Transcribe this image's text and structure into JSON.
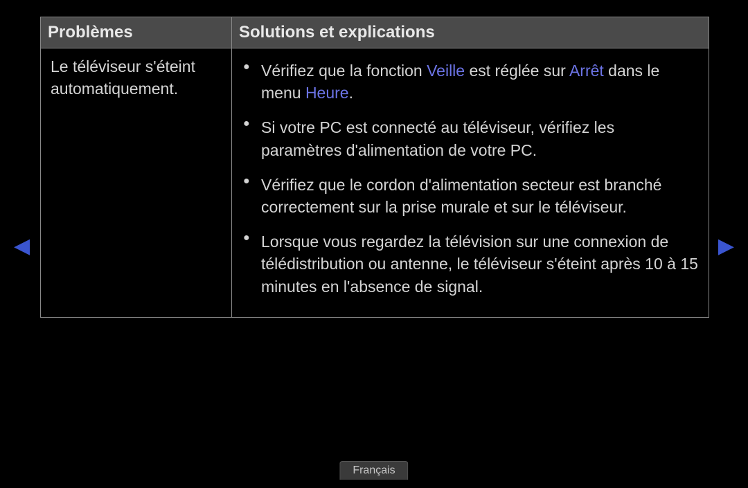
{
  "table": {
    "header": {
      "col1": "Problèmes",
      "col2": "Solutions et explications"
    },
    "problem": "Le téléviseur s'éteint automatiquement.",
    "solutions": {
      "s1": {
        "pre": "Vérifiez que la fonction ",
        "hl1": "Veille",
        "mid1": " est réglée sur ",
        "hl2": "Arrêt",
        "mid2": " dans le menu ",
        "hl3": "Heure",
        "post": "."
      },
      "s2": "Si votre PC est connecté au téléviseur, vérifiez les paramètres d'alimentation de votre PC.",
      "s3": "Vérifiez que le cordon d'alimentation secteur est branché correctement sur la prise murale et sur le téléviseur.",
      "s4": "Lorsque vous regardez la télévision sur une connexion de télédistribution ou antenne, le téléviseur s'éteint après 10 à 15 minutes en l'absence de signal."
    }
  },
  "nav": {
    "prev": "◀",
    "next": "▶"
  },
  "language": "Français"
}
